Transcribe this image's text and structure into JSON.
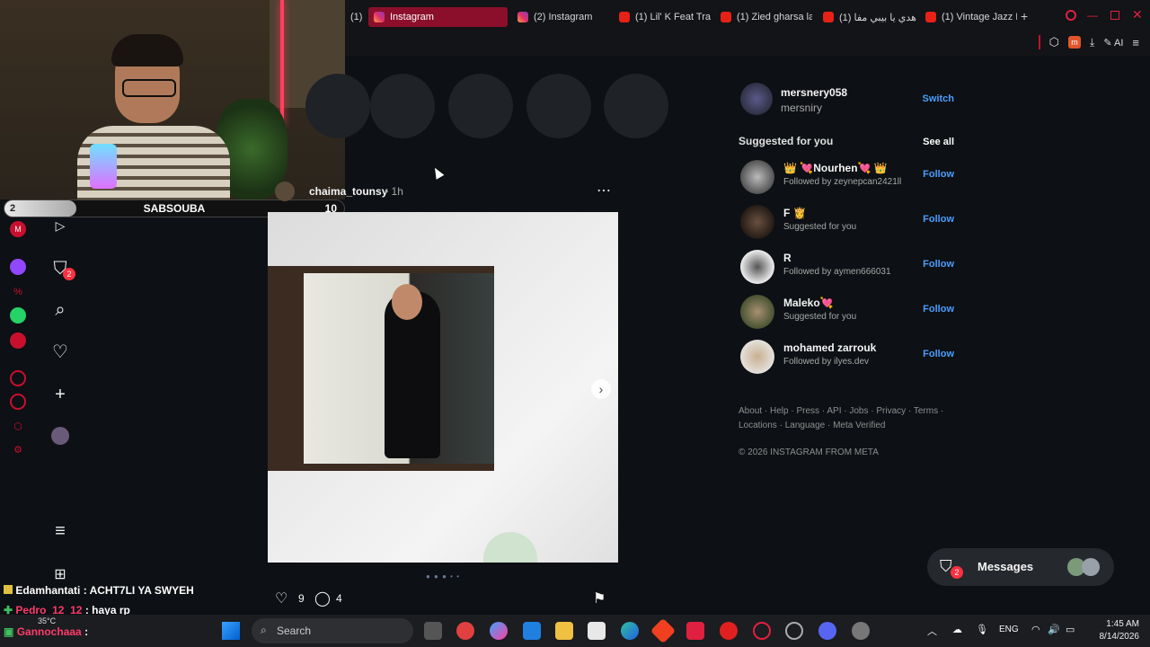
{
  "tabs": [
    {
      "label": "(1)",
      "icon": "youtube-icon"
    },
    {
      "label": "Instagram",
      "icon": "instagram-icon",
      "active": true
    },
    {
      "label": "(2) Instagram",
      "icon": "instagram-icon"
    },
    {
      "label": "(1) Lil' K Feat Tra",
      "icon": "youtube-icon"
    },
    {
      "label": "(1) Zied gharsa la",
      "icon": "youtube-icon"
    },
    {
      "label": "(1) هدي يا بيبي مفا",
      "icon": "youtube-icon"
    },
    {
      "label": "(1) Vintage Jazz N",
      "icon": "youtube-icon"
    }
  ],
  "toolbar": {
    "ai_label": "AI"
  },
  "overlay": {
    "level": "2",
    "streamer": "SABSOUBA",
    "count": "10"
  },
  "profile": {
    "username": "mersnery058",
    "fullname": "mersniry",
    "switch": "Switch"
  },
  "suggested": {
    "title": "Suggested for you",
    "see_all": "See all",
    "items": [
      {
        "name": "👑 💘Nourhen💘 👑",
        "sub": "Followed by zeynepcan2421ll",
        "follow": "Follow"
      },
      {
        "name": "F 👸",
        "sub": "Suggested for you",
        "follow": "Follow"
      },
      {
        "name": "R",
        "sub": "Followed by aymen666031",
        "follow": "Follow"
      },
      {
        "name": "Maleko💘",
        "sub": "Suggested for you",
        "follow": "Follow"
      },
      {
        "name": "mohamed zarrouk",
        "sub": "Followed by ilyes.dev",
        "follow": "Follow"
      }
    ]
  },
  "footer": {
    "links": "About · Help · Press · API · Jobs · Privacy · Terms · Locations · Language · Meta Verified",
    "copyright": "© 2026 INSTAGRAM FROM META"
  },
  "post": {
    "username": "chaima_tounsy",
    "time": "• 1h",
    "likes": "9",
    "comments": "4"
  },
  "messages": {
    "label": "Messages",
    "badge": "2"
  },
  "nav_badge": "2",
  "chat": [
    {
      "user": "Edamhantati",
      "text": ": ACHT7LI YA SWYEH",
      "user_color": "#ffffff"
    },
    {
      "user": "Pedro_12_12",
      "text": ": haya rp",
      "user_color": "#ff3b6b"
    },
    {
      "user": "Gannochaaa",
      "text": ":",
      "user_color": "#ff3b6b"
    }
  ],
  "weather": "35°C",
  "taskbar": {
    "search": "Search",
    "lang": "ENG",
    "time": "1:45 AM",
    "date": "8/14/2026"
  }
}
